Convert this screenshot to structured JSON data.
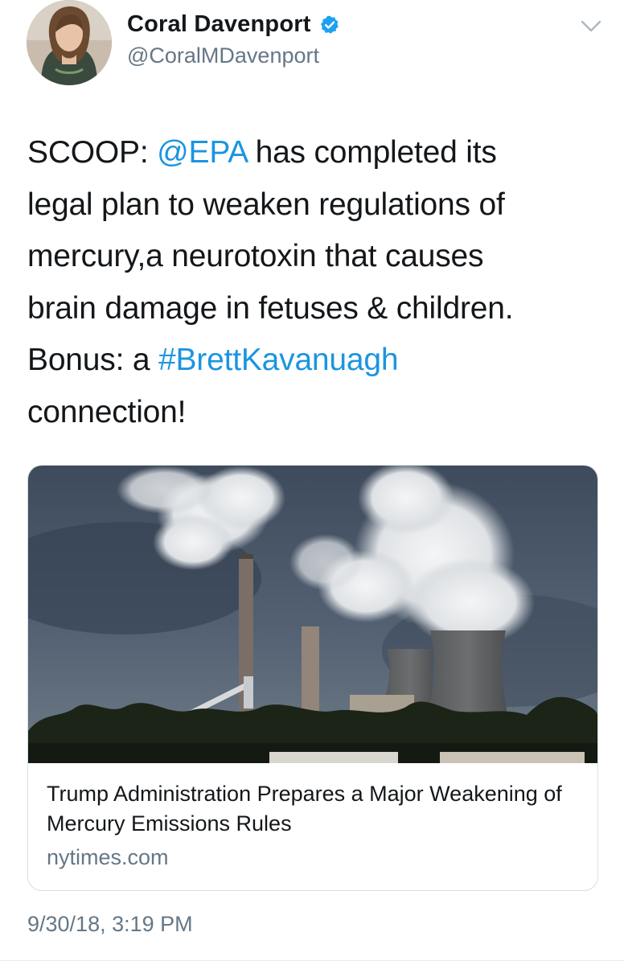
{
  "author": {
    "display_name": "Coral Davenport",
    "handle": "@CoralMDavenport",
    "verified": true,
    "avatar_icon": "profile-photo"
  },
  "menu": {
    "icon": "chevron-down-icon"
  },
  "tweet": {
    "line1_prefix": "SCOOP: ",
    "mention": "@EPA",
    "line1_suffix": " has completed its",
    "line2": "legal plan to weaken regulations of",
    "line3": "mercury,a neurotoxin that causes",
    "line4": "brain damage in fetuses & children.",
    "line5_prefix": "Bonus: a ",
    "hashtag": "#BrettKavanuagh",
    "line6": "connection!"
  },
  "card": {
    "title": "Trump Administration Prepares a Major Weakening of Mercury Emissions Rules",
    "domain": "nytimes.com",
    "image": "power-plant-smokestacks-photo"
  },
  "timestamp": "9/30/18, 3:19 PM",
  "colors": {
    "link": "#1b95e0",
    "secondary_text": "#657786",
    "primary_text": "#14171a",
    "verified_badge": "#1da1f2"
  }
}
